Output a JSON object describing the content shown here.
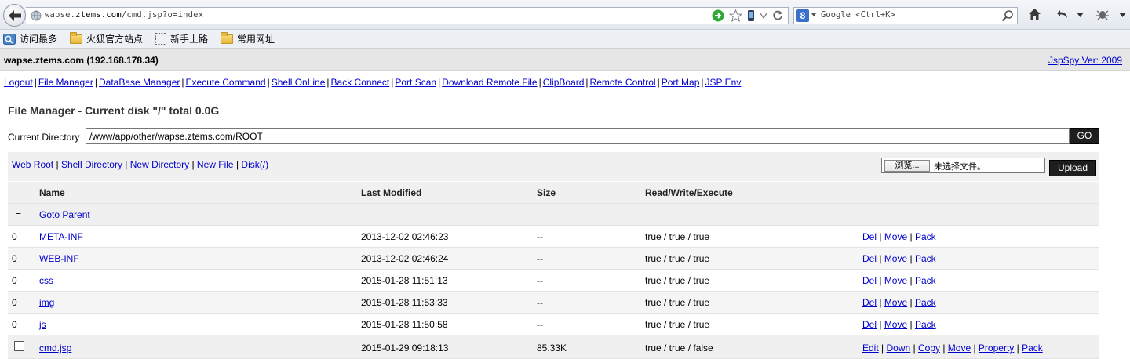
{
  "browser": {
    "url_prefix": "wapse.",
    "url_domain": "ztems.com",
    "url_path": "/cmd.jsp?o=index",
    "search_placeholder": "Google <Ctrl+K>",
    "search_engine_letter": "8"
  },
  "bookmarks": [
    {
      "label": "访问最多",
      "icon": "most-visited-icon"
    },
    {
      "label": "火狐官方站点",
      "icon": "folder-icon"
    },
    {
      "label": "新手上路",
      "icon": "page-icon"
    },
    {
      "label": "常用网址",
      "icon": "folder-icon"
    }
  ],
  "page": {
    "host_title": "wapse.ztems.com (192.168.178.34)",
    "version_link": "JspSpy Ver: 2009",
    "menu": [
      "Logout",
      "File Manager",
      "DataBase Manager",
      "Execute Command",
      "Shell OnLine",
      "Back Connect",
      "Port Scan",
      "Download Remote File",
      "ClipBoard",
      "Remote Control",
      "Port Map",
      "JSP Env"
    ],
    "fm_title": "File Manager - Current disk \"/\" total 0.0G",
    "current_directory_label": "Current Directory",
    "current_directory_value": "/www/app/other/wapse.ztems.com/ROOT",
    "go_label": "GO",
    "quick_links": [
      "Web Root",
      "Shell Directory",
      "New Directory",
      "New File",
      "Disk(/)"
    ],
    "browse_label": "浏览...",
    "no_file_label": "未选择文件。",
    "upload_label": "Upload"
  },
  "table": {
    "headers": {
      "name": "Name",
      "modified": "Last Modified",
      "size": "Size",
      "rwx": "Read/Write/Execute"
    },
    "parent": {
      "marker": "=",
      "label": "Goto Parent"
    },
    "rows": [
      {
        "sel": "0",
        "name": "META-INF",
        "modified": "2013-12-02 02:46:23",
        "size": "--",
        "rwx": "true / true / true",
        "actions": [
          "Del",
          "Move",
          "Pack"
        ]
      },
      {
        "sel": "0",
        "name": "WEB-INF",
        "modified": "2013-12-02 02:46:24",
        "size": "--",
        "rwx": "true / true / true",
        "actions": [
          "Del",
          "Move",
          "Pack"
        ]
      },
      {
        "sel": "0",
        "name": "css",
        "modified": "2015-01-28 11:51:13",
        "size": "--",
        "rwx": "true / true / true",
        "actions": [
          "Del",
          "Move",
          "Pack"
        ]
      },
      {
        "sel": "0",
        "name": "img",
        "modified": "2015-01-28 11:53:33",
        "size": "--",
        "rwx": "true / true / true",
        "actions": [
          "Del",
          "Move",
          "Pack"
        ]
      },
      {
        "sel": "0",
        "name": "js",
        "modified": "2015-01-28 11:50:58",
        "size": "--",
        "rwx": "true / true / true",
        "actions": [
          "Del",
          "Move",
          "Pack"
        ]
      },
      {
        "sel": "checkbox",
        "name": "cmd.jsp",
        "modified": "2015-01-29 09:18:13",
        "size": "85.33K",
        "rwx": "true / true / false",
        "actions": [
          "Edit",
          "Down",
          "Copy",
          "Move",
          "Property",
          "Pack"
        ]
      }
    ]
  },
  "colors": {
    "link": "#0000cc",
    "button_dark": "#1e1e1e",
    "row_band": "#f0f0f0"
  }
}
